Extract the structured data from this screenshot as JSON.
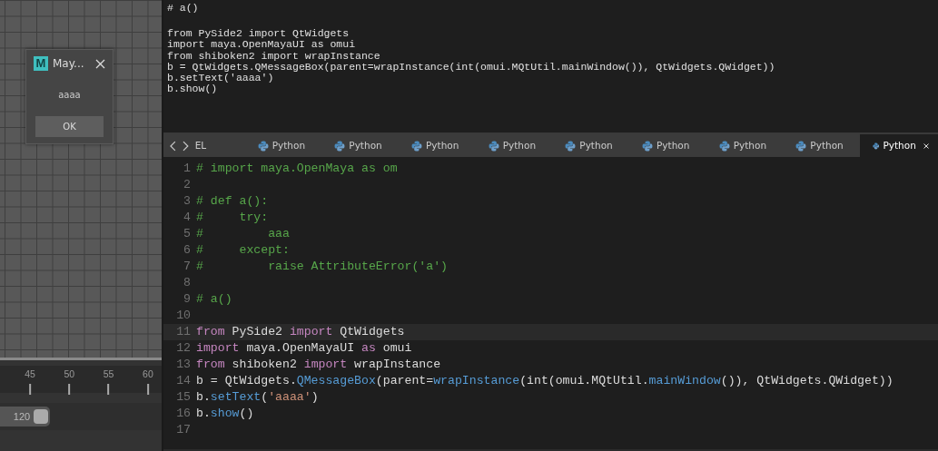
{
  "dialog": {
    "logo": "M",
    "title": "May...",
    "message": "aaaa",
    "button": "OK"
  },
  "timeline": {
    "ticks": [
      "45",
      "50",
      "55",
      "60"
    ]
  },
  "range": {
    "end": "120",
    "level": 0.31
  },
  "output": {
    "blocks": [
      [
        "# a()"
      ],
      [
        "from PySide2 import QtWidgets",
        "import maya.OpenMayaUI as omui",
        "from shiboken2 import wrapInstance",
        "b = QtWidgets.QMessageBox(parent=wrapInstance(int(omui.MQtUtil.mainWindow()), QtWidgets.QWidget))",
        "b.setText('aaaa')",
        "b.show()"
      ]
    ]
  },
  "tabs": [
    {
      "label": "EL",
      "kind": "plain",
      "selected": false
    },
    {
      "label": "Python",
      "kind": "python",
      "selected": false
    },
    {
      "label": "Python",
      "kind": "python",
      "selected": false
    },
    {
      "label": "Python",
      "kind": "python",
      "selected": false
    },
    {
      "label": "Python",
      "kind": "python",
      "selected": false
    },
    {
      "label": "Python",
      "kind": "python",
      "selected": false
    },
    {
      "label": "Python",
      "kind": "python",
      "selected": false
    },
    {
      "label": "Python",
      "kind": "python",
      "selected": false
    },
    {
      "label": "Python",
      "kind": "python",
      "selected": false
    },
    {
      "label": "Python",
      "kind": "python",
      "selected": true
    }
  ],
  "editor": {
    "lines": [
      {
        "number": "1",
        "current": false,
        "tokens": [
          {
            "text": "# import maya.OpenMaya as om",
            "kind": "comment"
          }
        ]
      },
      {
        "number": "2",
        "current": false
      },
      {
        "number": "3",
        "current": false,
        "tokens": [
          {
            "text": "# def a():",
            "kind": "comment"
          }
        ]
      },
      {
        "number": "4",
        "current": false,
        "tokens": [
          {
            "text": "#     try:",
            "kind": "comment"
          }
        ]
      },
      {
        "number": "5",
        "current": false,
        "tokens": [
          {
            "text": "#         aaa",
            "kind": "comment"
          }
        ]
      },
      {
        "number": "6",
        "current": false,
        "tokens": [
          {
            "text": "#     except:",
            "kind": "comment"
          }
        ]
      },
      {
        "number": "7",
        "current": false,
        "tokens": [
          {
            "text": "#         raise AttributeError('a')",
            "kind": "comment"
          }
        ]
      },
      {
        "number": "8",
        "current": false
      },
      {
        "number": "9",
        "current": false,
        "tokens": [
          {
            "text": "# a()",
            "kind": "comment"
          }
        ]
      },
      {
        "number": "10",
        "current": false
      },
      {
        "number": "11",
        "current": true,
        "tokens": [
          {
            "text": "from",
            "kind": "keyword"
          },
          {
            "text": " PySide2 ",
            "kind": "plain"
          },
          {
            "text": "import",
            "kind": "keyword"
          },
          {
            "text": " QtWidgets",
            "kind": "plain"
          }
        ]
      },
      {
        "number": "12",
        "current": false,
        "tokens": [
          {
            "text": "import",
            "kind": "keyword"
          },
          {
            "text": " maya.OpenMayaUI ",
            "kind": "plain"
          },
          {
            "text": "as",
            "kind": "keyword"
          },
          {
            "text": " omui",
            "kind": "plain"
          }
        ]
      },
      {
        "number": "13",
        "current": false,
        "tokens": [
          {
            "text": "from",
            "kind": "keyword"
          },
          {
            "text": " shiboken2 ",
            "kind": "plain"
          },
          {
            "text": "import",
            "kind": "keyword"
          },
          {
            "text": " wrapInstance",
            "kind": "plain"
          }
        ]
      },
      {
        "number": "14",
        "current": false,
        "tokens": [
          {
            "text": "b = QtWidgets.",
            "kind": "plain"
          },
          {
            "text": "QMessageBox",
            "kind": "function"
          },
          {
            "text": "(parent=",
            "kind": "plain"
          },
          {
            "text": "wrapInstance",
            "kind": "function"
          },
          {
            "text": "(int(omui.MQtUtil.",
            "kind": "plain"
          },
          {
            "text": "mainWindow",
            "kind": "function"
          },
          {
            "text": "()), QtWidgets.QWidget))",
            "kind": "plain"
          }
        ]
      },
      {
        "number": "15",
        "current": false,
        "tokens": [
          {
            "text": "b.",
            "kind": "plain"
          },
          {
            "text": "setText",
            "kind": "function"
          },
          {
            "text": "(",
            "kind": "plain"
          },
          {
            "text": "'aaaa'",
            "kind": "string"
          },
          {
            "text": ")",
            "kind": "plain"
          }
        ]
      },
      {
        "number": "16",
        "current": false,
        "tokens": [
          {
            "text": "b.",
            "kind": "plain"
          },
          {
            "text": "show",
            "kind": "function"
          },
          {
            "text": "()",
            "kind": "plain"
          }
        ]
      },
      {
        "number": "17",
        "current": false
      }
    ]
  }
}
